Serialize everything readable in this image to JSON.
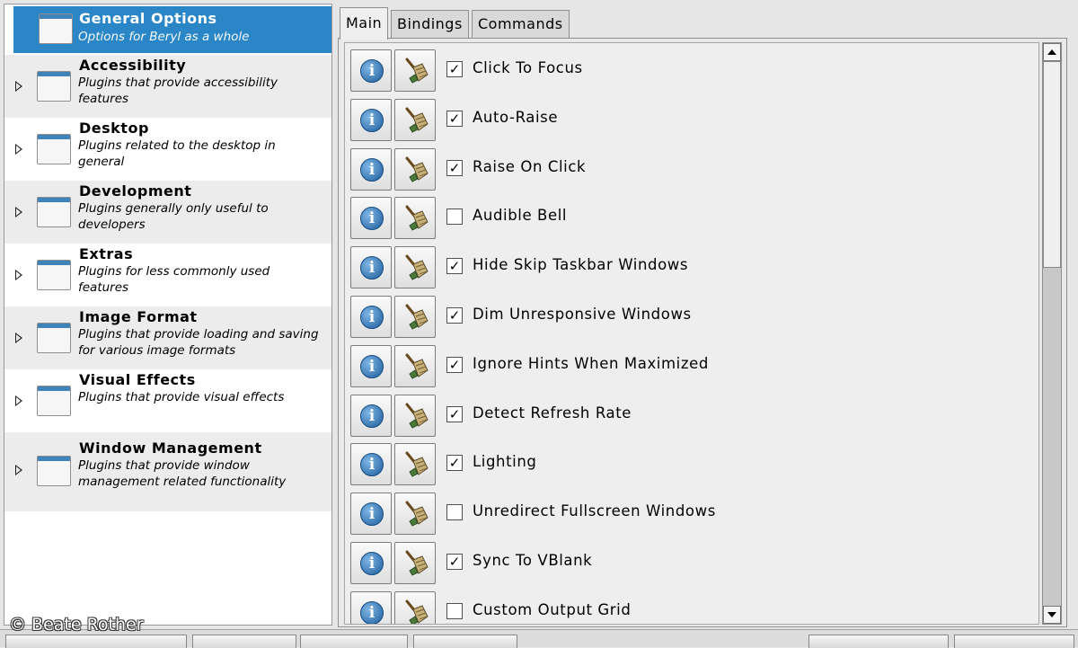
{
  "sidebar": {
    "categories": [
      {
        "title": "General Options",
        "desc": "Options for Beryl as a whole"
      },
      {
        "title": "Accessibility",
        "desc": "Plugins that provide accessibility features"
      },
      {
        "title": "Desktop",
        "desc": "Plugins related to the desktop in general"
      },
      {
        "title": "Development",
        "desc": "Plugins generally only useful to developers"
      },
      {
        "title": "Extras",
        "desc": "Plugins for less commonly used features"
      },
      {
        "title": "Image Format",
        "desc": "Plugins that provide loading and saving for various image formats"
      },
      {
        "title": "Visual Effects",
        "desc": "Plugins that provide visual effects"
      },
      {
        "title": "Window Management",
        "desc": "Plugins that provide window management related functionality"
      }
    ],
    "selected": "General Options"
  },
  "tabs": [
    {
      "label": "Main",
      "active": true
    },
    {
      "label": "Bindings",
      "active": false
    },
    {
      "label": "Commands",
      "active": false
    }
  ],
  "options": [
    {
      "label": "Click To Focus",
      "checked": true
    },
    {
      "label": "Auto-Raise",
      "checked": true
    },
    {
      "label": "Raise On Click",
      "checked": true
    },
    {
      "label": "Audible Bell",
      "checked": false
    },
    {
      "label": "Hide Skip Taskbar Windows",
      "checked": true
    },
    {
      "label": "Dim Unresponsive Windows",
      "checked": true
    },
    {
      "label": "Ignore Hints When Maximized",
      "checked": true
    },
    {
      "label": "Detect Refresh Rate",
      "checked": true
    },
    {
      "label": "Lighting",
      "checked": true
    },
    {
      "label": "Unredirect Fullscreen Windows",
      "checked": false
    },
    {
      "label": "Sync To VBlank",
      "checked": true
    },
    {
      "label": "Custom Output Grid",
      "checked": false
    }
  ],
  "icons": {
    "info": "info-icon",
    "reset": "broom-icon",
    "category": "window-icon",
    "expander": "expander-arrow-icon"
  },
  "colors": {
    "selection": "#2a86c6",
    "info_blue": "#1d5d9c"
  },
  "watermark": "© Beate Rother"
}
